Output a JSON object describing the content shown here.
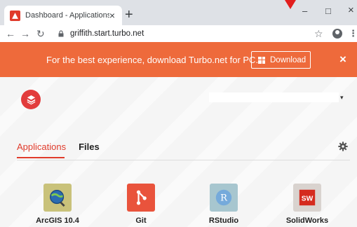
{
  "browser": {
    "tab_title": "Dashboard - Applications",
    "tab_close": "×",
    "new_tab": "+",
    "url": "griffith.start.turbo.net",
    "window_controls": {
      "minimize": "–",
      "maximize": "□",
      "close": "×"
    },
    "icons": [
      "back-arrow-icon",
      "forward-arrow-icon",
      "reload-icon",
      "lock-icon",
      "star-icon",
      "profile-icon",
      "menu-dots-icon"
    ]
  },
  "banner": {
    "message": "For the best experience, download Turbo.net for PC.",
    "download_label": "Download",
    "close": "×",
    "color": "#ee6a3b"
  },
  "header": {
    "logo_icon": "turbo-logo-icon",
    "user_caret": "▾"
  },
  "tabs": [
    {
      "label": "Applications",
      "active": true
    },
    {
      "label": "Files",
      "active": false
    }
  ],
  "accent_color": "#e03b2b",
  "apps": [
    {
      "name": "ArcGIS 10.4",
      "icon": "arcgis-icon"
    },
    {
      "name": "Git",
      "icon": "git-icon"
    },
    {
      "name": "RStudio",
      "icon": "rstudio-icon"
    },
    {
      "name": "SolidWorks",
      "icon": "solidworks-icon"
    }
  ]
}
